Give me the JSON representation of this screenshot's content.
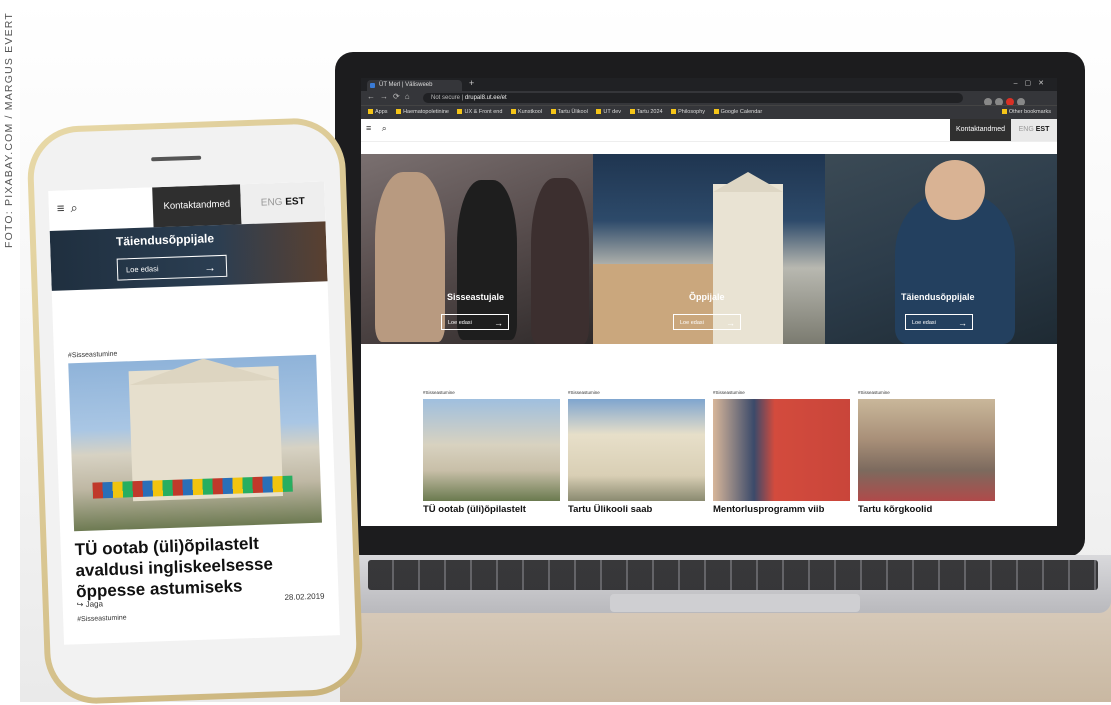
{
  "credit": "FOTO: PIXABAY.COM / MARGUS EVERT",
  "laptop": {
    "browser": {
      "tab_title": "ÜT Merl | Välisweeb",
      "url_prefix": "Not secure",
      "url": "drupal8.ut.ee/et",
      "bookmarks": [
        "Apps",
        "Haematopoletinine",
        "UX & Front end",
        "Kunstkool",
        "Tartu Ülikool",
        "UT dev",
        "Tartu 2024",
        "Philosophy",
        "Google Calendar"
      ],
      "other_bookmarks": "Other bookmarks"
    },
    "site": {
      "contact": "Kontaktandmed",
      "lang_eng": "ENG",
      "lang_est": "EST",
      "hero": [
        {
          "title": "Sisseastujale",
          "button": "Loe edasi"
        },
        {
          "title": "Õppijale",
          "button": "Loe edasi"
        },
        {
          "title": "Täiendusõppijale",
          "button": "Loe edasi"
        }
      ],
      "cards": [
        {
          "tag": "#Sisseastumine",
          "title": "TÜ ootab (üli)õpilastelt"
        },
        {
          "tag": "#Sisseastumine",
          "title": "Tartu Ülikooli saab"
        },
        {
          "tag": "#Sisseastumine",
          "title": "Mentorlusprogramm viib"
        },
        {
          "tag": "#Sisseastumine",
          "title": "Tartu kõrgkoolid"
        }
      ]
    }
  },
  "phone": {
    "contact": "Kontaktandmed",
    "lang_eng": "ENG",
    "lang_est": "EST",
    "banner_title": "Täiendusõppijale",
    "banner_button": "Loe edasi",
    "tag": "#Sisseastumine",
    "article_title": "TÜ ootab (üli)õpilastelt avaldusi ingliskeelsesse õppesse astumiseks",
    "share": "Jaga",
    "date": "28.02.2019",
    "tag2": "#Sisseastumine"
  }
}
